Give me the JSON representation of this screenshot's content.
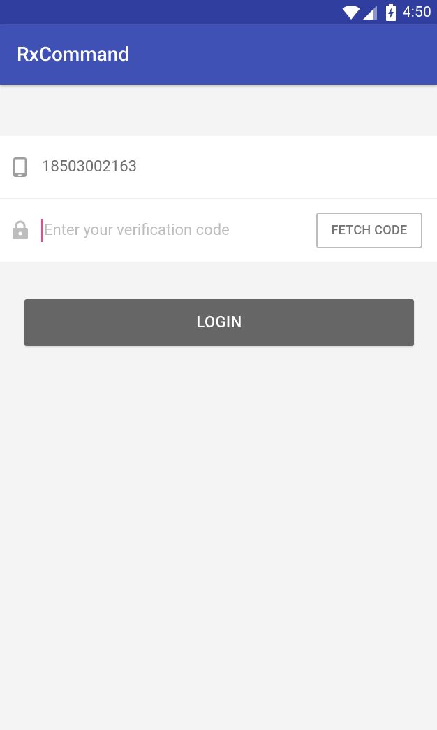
{
  "status_bar": {
    "time": "4:50",
    "icons": [
      "wifi-icon",
      "signal-icon",
      "battery-charging-icon"
    ]
  },
  "app_bar": {
    "title": "RxCommand"
  },
  "form": {
    "phone": {
      "icon": "phone-icon",
      "value": "18503002163"
    },
    "verification": {
      "icon": "lock-icon",
      "placeholder": "Enter your verification code",
      "value": "",
      "fetch_label": "FETCH CODE"
    }
  },
  "login_label": "LOGIN",
  "colors": {
    "status_bar": "#303f9f",
    "app_bar": "#3f51b5",
    "accent": "#ff4081",
    "login_button": "#666666",
    "background": "#f4f4f4"
  }
}
